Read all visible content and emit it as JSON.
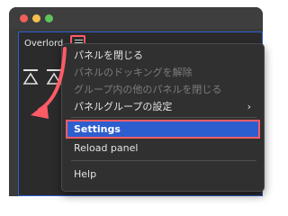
{
  "panel": {
    "title": "Overlord",
    "menu_icon": "hamburger-menu-icon",
    "tool_icons": [
      "align-triangle-icon",
      "align-triangle-outline-icon"
    ]
  },
  "menu": {
    "items": [
      {
        "label": "パネルを閉じる",
        "enabled": true
      },
      {
        "label": "パネルのドッキングを解除",
        "enabled": false
      },
      {
        "label": "グループ内の他のパネルを閉じる",
        "enabled": false
      },
      {
        "label": "パネルグループの設定",
        "enabled": true,
        "submenu": true
      },
      {
        "label": "Settings",
        "enabled": true,
        "highlighted": true
      },
      {
        "label": "Reload panel",
        "enabled": true
      },
      {
        "label": "Help",
        "enabled": true
      }
    ],
    "submenu_glyph": "›"
  },
  "colors": {
    "highlight": "#2c5ecf",
    "annotation": "#ff5b66",
    "panel_border": "#2f5fd3"
  }
}
